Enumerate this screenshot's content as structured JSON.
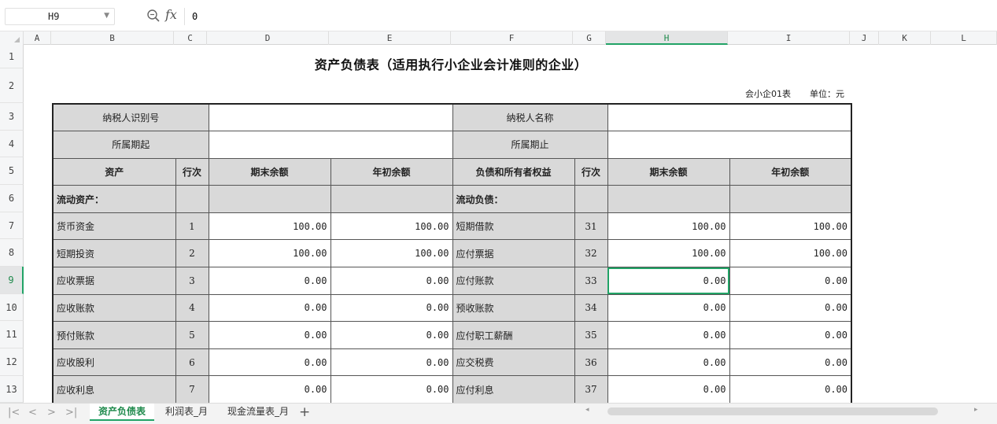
{
  "formula_bar": {
    "cell_ref": "H9",
    "fx_label": "fx",
    "formula": "0"
  },
  "columns": [
    "A",
    "B",
    "C",
    "D",
    "E",
    "F",
    "G",
    "H",
    "I",
    "J",
    "K",
    "L"
  ],
  "rows": [
    "1",
    "2",
    "3",
    "4",
    "5",
    "6",
    "7",
    "8",
    "9",
    "10",
    "11",
    "12",
    "13"
  ],
  "selected": {
    "column": "H",
    "row": "9"
  },
  "sheet": {
    "title": "资产负债表（适用执行小企业会计准则的企业）",
    "form_code": "会小企01表",
    "unit": "单位：元",
    "taxpayer_id_label": "纳税人识别号",
    "taxpayer_name_label": "纳税人名称",
    "period_start_label": "所属期起",
    "period_end_label": "所属期止",
    "headers": {
      "assets": "资产",
      "line": "行次",
      "end_balance": "期末余额",
      "begin_balance": "年初余额",
      "liabilities": "负债和所有者权益",
      "line2": "行次",
      "end_balance2": "期末余额",
      "begin_balance2": "年初余额"
    },
    "section_current_assets": "流动资产：",
    "section_current_liabilities": "流动负债：",
    "rows": [
      {
        "asset": "货币资金",
        "line": "1",
        "end": "100.00",
        "begin": "100.00",
        "liab": "短期借款",
        "line2": "31",
        "end2": "100.00",
        "begin2": "100.00"
      },
      {
        "asset": "短期投资",
        "line": "2",
        "end": "100.00",
        "begin": "100.00",
        "liab": "应付票据",
        "line2": "32",
        "end2": "100.00",
        "begin2": "100.00"
      },
      {
        "asset": "应收票据",
        "line": "3",
        "end": "0.00",
        "begin": "0.00",
        "liab": "应付账款",
        "line2": "33",
        "end2": "0.00",
        "begin2": "0.00"
      },
      {
        "asset": "应收账款",
        "line": "4",
        "end": "0.00",
        "begin": "0.00",
        "liab": "预收账款",
        "line2": "34",
        "end2": "0.00",
        "begin2": "0.00"
      },
      {
        "asset": "预付账款",
        "line": "5",
        "end": "0.00",
        "begin": "0.00",
        "liab": "应付职工薪酬",
        "line2": "35",
        "end2": "0.00",
        "begin2": "0.00"
      },
      {
        "asset": "应收股利",
        "line": "6",
        "end": "0.00",
        "begin": "0.00",
        "liab": "应交税费",
        "line2": "36",
        "end2": "0.00",
        "begin2": "0.00"
      },
      {
        "asset": "应收利息",
        "line": "7",
        "end": "0.00",
        "begin": "0.00",
        "liab": "应付利息",
        "line2": "37",
        "end2": "0.00",
        "begin2": "0.00"
      }
    ]
  },
  "tabs": [
    {
      "label": "资产负债表",
      "active": true
    },
    {
      "label": "利润表_月",
      "active": false
    },
    {
      "label": "现金流量表_月",
      "active": false
    }
  ],
  "icons": {
    "zoom": "zoom-search-icon",
    "nav_first": "first-sheet-icon",
    "nav_prev": "prev-sheet-icon",
    "nav_next": "next-sheet-icon",
    "nav_last": "last-sheet-icon",
    "add_sheet": "add-sheet-icon"
  },
  "colors": {
    "accent": "#21a366",
    "header_gray": "#d9d9d9"
  }
}
